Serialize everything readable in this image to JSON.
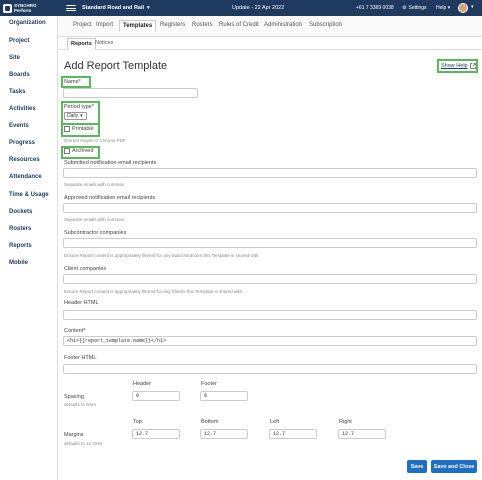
{
  "topbar": {
    "logo_line1": "SYNCHRO",
    "logo_line2": "Perform",
    "project_name": "Standard Road and Rail",
    "update_text": "Update - 22 Apr 2022",
    "phone": "+61 7 3369 0038",
    "settings_label": "Settings",
    "help_label": "Help"
  },
  "sidebar": {
    "items": [
      "Organization",
      "Project",
      "Site",
      "Boards",
      "Tasks",
      "Activities",
      "Events",
      "Progress",
      "Resources",
      "Attendance",
      "Time & Usage",
      "Dockets",
      "Rosters",
      "Reports",
      "Mobile"
    ]
  },
  "tabs": [
    "Project",
    "Import",
    "Templates",
    "Registers",
    "Rosters",
    "Rules of Credit",
    "Administration",
    "Subscription"
  ],
  "subtabs": [
    "Reports",
    "Notices"
  ],
  "page": {
    "title": "Add Report Template",
    "show_help": "Show Help"
  },
  "form": {
    "name_label": "Name*",
    "period_label": "Period type*",
    "period_value": "Daily",
    "printable_label": "Printable",
    "printable_hint": "Current engine is Chrome PDF",
    "archived_label": "Archived",
    "submitted_label": "Submitted notification email recipients",
    "submitted_hint": "Separate emails with commas.",
    "approved_label": "Approved notification email recipients",
    "approved_hint": "Separate emails with commas.",
    "subcontractor_label": "Subcontractor companies",
    "subcontractor_hint": "Ensure Report content is appropriately filtered for any Subcontractors this Template is shared with",
    "client_label": "Client companies",
    "client_hint": "Ensure Report content is appropriately filtered for any Clients this Template is shared with.",
    "header_html_label": "Header HTML",
    "content_label": "Content*",
    "content_value": "<h1>{{report_template.name}}</h1>",
    "footer_html_label": "Footer HTML",
    "spacing_label": "Spacing",
    "spacing_hint": "defaults to 0mm",
    "spacing_header_label": "Header",
    "spacing_header_value": "0",
    "spacing_footer_label": "Footer",
    "spacing_footer_value": "0",
    "margins_label": "Margins",
    "margins_hint": "defaults to 12.7mm",
    "margin_top_label": "Top",
    "margin_top_value": "12.7",
    "margin_bottom_label": "Bottom",
    "margin_bottom_value": "12.7",
    "margin_left_label": "Left",
    "margin_left_value": "12.7",
    "margin_right_label": "Right",
    "margin_right_value": "12.7"
  },
  "buttons": {
    "save": "Save",
    "save_close": "Save and Close"
  },
  "colors": {
    "topbar": "#1f3a5f",
    "highlight": "#5cb85c",
    "button": "#1f6fc5"
  }
}
